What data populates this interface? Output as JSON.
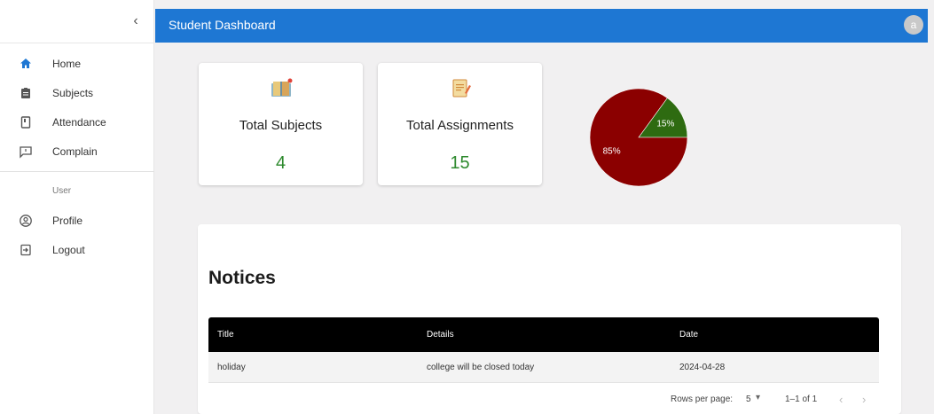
{
  "sidebar": {
    "items": [
      {
        "label": "Home",
        "icon": "home-icon"
      },
      {
        "label": "Subjects",
        "icon": "clipboard-icon"
      },
      {
        "label": "Attendance",
        "icon": "attendance-icon"
      },
      {
        "label": "Complain",
        "icon": "feedback-icon"
      }
    ],
    "section_label": "User",
    "user_items": [
      {
        "label": "Profile",
        "icon": "account-circle-icon"
      },
      {
        "label": "Logout",
        "icon": "logout-icon"
      }
    ],
    "collapse_glyph": "‹"
  },
  "header": {
    "title": "Student Dashboard",
    "avatar_initial": "a"
  },
  "stats": {
    "subjects": {
      "title": "Total Subjects",
      "value": "4",
      "icon": "book-icon"
    },
    "assignments": {
      "title": "Total Assignments",
      "value": "15",
      "icon": "assignment-icon"
    }
  },
  "chart_data": {
    "type": "pie",
    "values": [
      85,
      15
    ],
    "labels": [
      "85%",
      "15%"
    ],
    "colors": [
      "#8b0000",
      "#2e6b11"
    ]
  },
  "notices": {
    "heading": "Notices",
    "columns": [
      "Title",
      "Details",
      "Date"
    ],
    "rows": [
      [
        "holiday",
        "college will be closed today",
        "2024-04-28"
      ]
    ],
    "pagination": {
      "rows_per_page_label": "Rows per page:",
      "rows_per_page": "5",
      "range": "1–1 of 1"
    }
  },
  "colors": {
    "header": "#1e77d3",
    "accent_green": "#2e8a2e",
    "table_head": "#000000"
  }
}
